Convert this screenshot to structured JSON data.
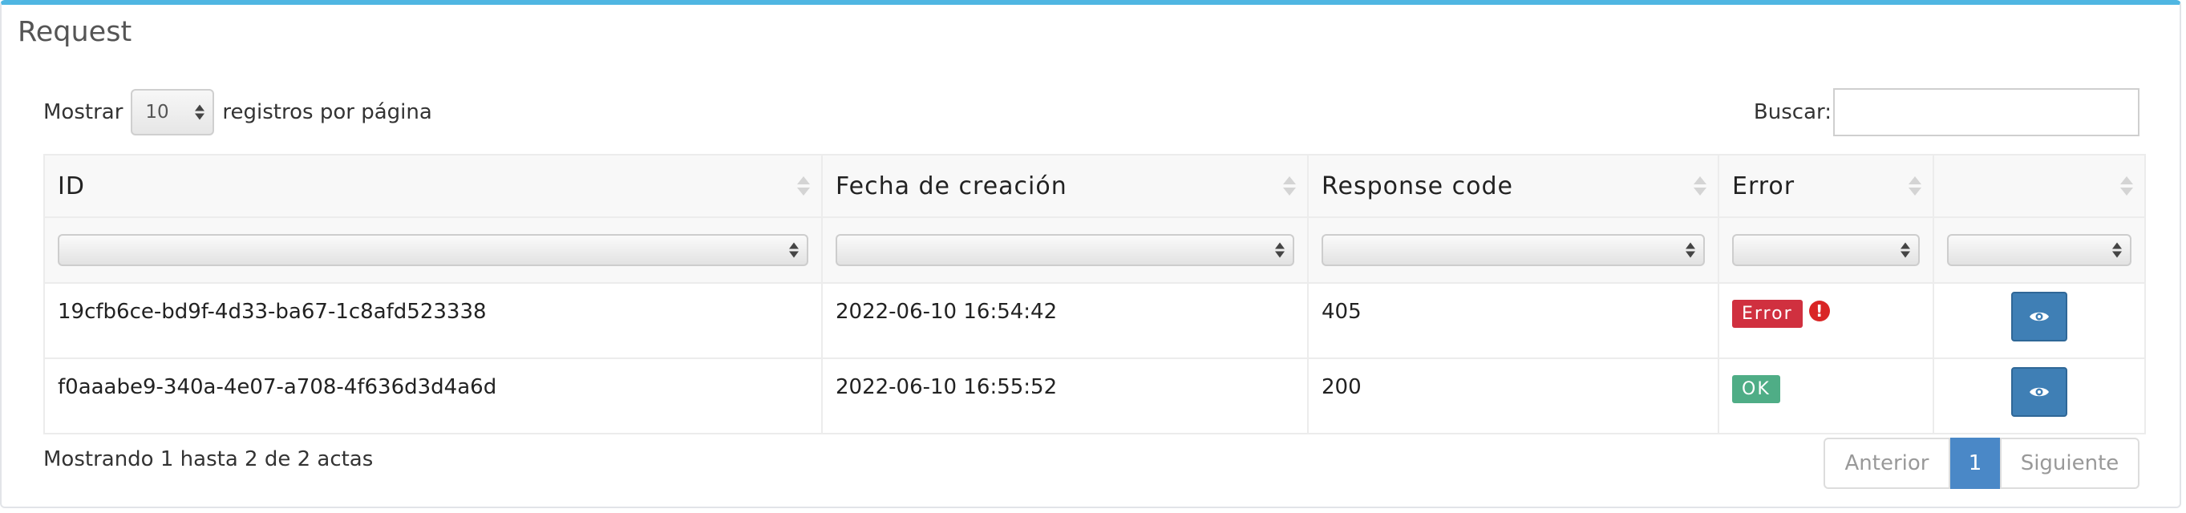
{
  "panel": {
    "title": "Request"
  },
  "length": {
    "prefix": "Mostrar",
    "selected": "10",
    "suffix": "registros por página"
  },
  "search": {
    "label": "Buscar:",
    "value": ""
  },
  "table": {
    "columns": [
      "ID",
      "Fecha de creación",
      "Response code",
      "Error",
      ""
    ],
    "rows": [
      {
        "id": "19cfb6ce-bd9f-4d33-ba67-1c8afd523338",
        "created": "2022-06-10 16:54:42",
        "response_code": "405",
        "status": "Error",
        "status_type": "error"
      },
      {
        "id": "f0aaabe9-340a-4e07-a708-4f636d3d4a6d",
        "created": "2022-06-10 16:55:52",
        "response_code": "200",
        "status": "OK",
        "status_type": "ok"
      }
    ]
  },
  "footer": {
    "info": "Mostrando 1 hasta 2 de 2 actas"
  },
  "pagination": {
    "prev": "Anterior",
    "current": "1",
    "next": "Siguiente"
  },
  "colors": {
    "accent": "#4fb6e2",
    "error": "#d0303f",
    "ok": "#4fad86",
    "primary_button": "#3f7fb5",
    "page_active": "#4a88c7"
  },
  "icons": {
    "view": "eye-icon",
    "warning": "exclamation-circle-icon"
  }
}
